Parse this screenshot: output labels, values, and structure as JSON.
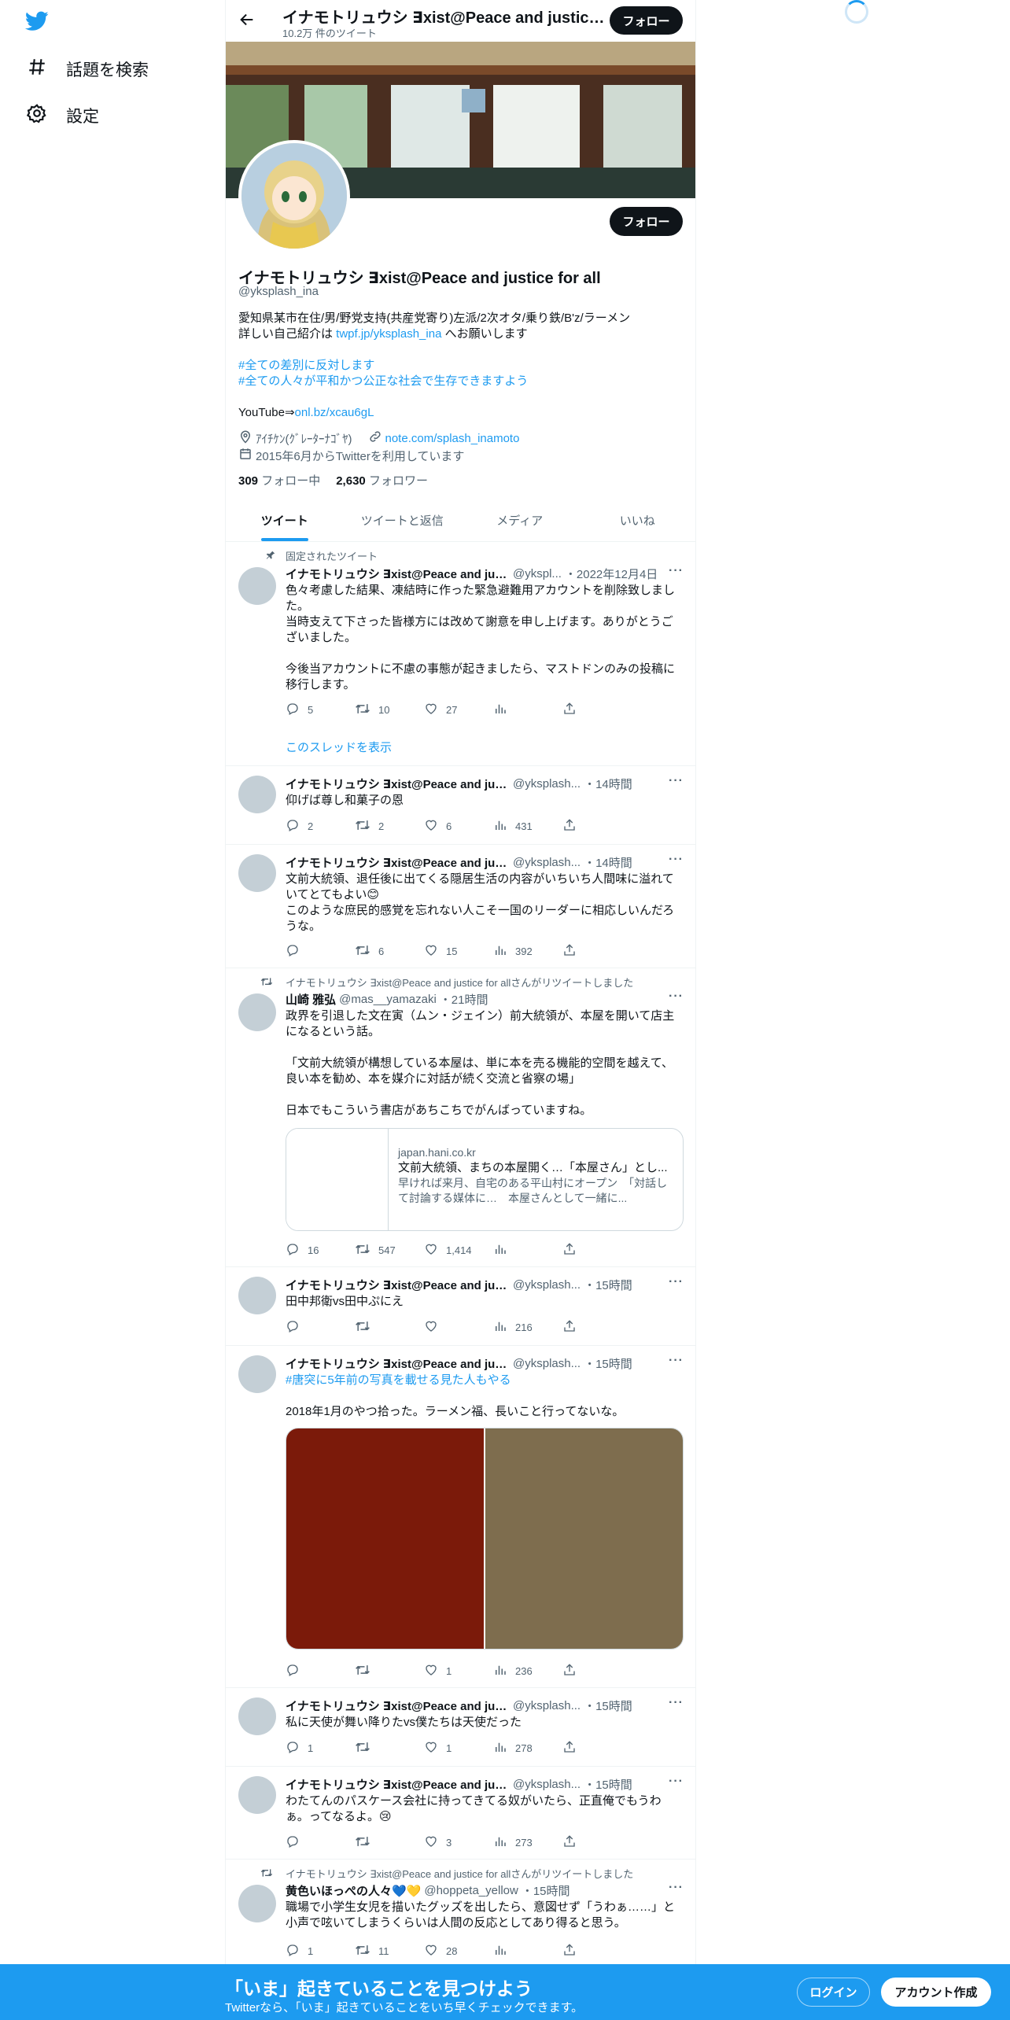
{
  "nav": {
    "explore_label": "話題を検索",
    "settings_label": "設定"
  },
  "header": {
    "title": "イナモトリュウシ ∃xist@Peace and justice for all",
    "tweet_count": "10.2万 件のツイート",
    "follow_label": "フォロー"
  },
  "profile": {
    "follow_label": "フォロー",
    "name": "イナモトリュウシ ∃xist@Peace and justice for all",
    "handle": "@yksplash_ina",
    "bio_line1": "愛知県某市在住/男/野党支持(共産党寄り)左派/2次オタ/乗り鉄/B'z/ラーメン",
    "bio_line2_prefix": "詳しい自己紹介は ",
    "bio_line2_link": "twpf.jp/yksplash_ina",
    "bio_line2_suffix": " へお願いします",
    "bio_hashtag1": "#全ての差別に反対します",
    "bio_hashtag2": "#全ての人々が平和かつ公正な社会で生存できますよう",
    "bio_yt_prefix": "YouTube⇒",
    "bio_yt_link": "onl.bz/xcau6gL",
    "location": "ｱｲﾁｹﾝ(ｸﾞﾚｰﾀｰﾅｺﾞﾔ)",
    "website": "note.com/splash_inamoto",
    "joined": "2015年6月からTwitterを利用しています",
    "following_count": "309",
    "following_label": "フォロー中",
    "followers_count": "2,630",
    "followers_label": "フォロワー"
  },
  "tabs": [
    "ツイート",
    "ツイートと返信",
    "メディア",
    "いいね"
  ],
  "tweets": [
    {
      "pinned_label": "固定されたツイート",
      "name": "イナモトリュウシ ∃xist@Peace and jus...",
      "handle": "@ykspl...",
      "time": "・2022年12月4日",
      "text": "色々考慮した結果、凍結時に作った緊急避難用アカウントを削除致しました。\n当時支えて下さった皆様方には改めて謝意を申し上げます。ありがとうございました。\n\n今後当アカウントに不慮の事態が起きましたら、マストドンのみの投稿に移行します。",
      "replies": "5",
      "retweets": "10",
      "likes": "27",
      "views": "",
      "thread_link": "このスレッドを表示"
    },
    {
      "name": "イナモトリュウシ ∃xist@Peace and justice f...",
      "handle": "@yksplash...",
      "time": "・14時間",
      "text": "仰げば尊し和菓子の恩",
      "replies": "2",
      "retweets": "2",
      "likes": "6",
      "views": "431"
    },
    {
      "name": "イナモトリュウシ ∃xist@Peace and justice f...",
      "handle": "@yksplash...",
      "time": "・14時間",
      "text": "文前大統領、退任後に出てくる隠居生活の内容がいちいち人間味に溢れていてとてもよい😊\nこのような庶民的感覚を忘れない人こそ一国のリーダーに相応しいんだろうな。",
      "replies": "",
      "retweets": "6",
      "likes": "15",
      "views": "392"
    },
    {
      "retweeted_by": "イナモトリュウシ ∃xist@Peace and justice for allさんがリツイートしました",
      "name": "山崎 雅弘",
      "handle": "@mas__yamazaki",
      "time": "・21時間",
      "text": "政界を引退した文在寅（ムン・ジェイン）前大統領が、本屋を開いて店主になるという話。\n\n「文前大統領が構想している本屋は、単に本を売る機能的空間を越えて、良い本を勧め、本を媒介に対話が続く交流と省察の場」\n\n日本でもこういう書店があちこちでがんばっていますね。",
      "card_domain": "japan.hani.co.kr",
      "card_title": "文前大統領、まちの本屋開く…「本屋さん」とし...",
      "card_desc": "早ければ来月、自宅のある平山村にオープン　「対話して討論する媒体に…　本屋さんとして一緒に...",
      "replies": "16",
      "retweets": "547",
      "likes": "1,414",
      "views": ""
    },
    {
      "name": "イナモトリュウシ ∃xist@Peace and justice f...",
      "handle": "@yksplash...",
      "time": "・15時間",
      "text": "田中邦衛vs田中ぷにえ",
      "replies": "",
      "retweets": "",
      "likes": "",
      "views": "216"
    },
    {
      "name": "イナモトリュウシ ∃xist@Peace and justice f...",
      "handle": "@yksplash...",
      "time": "・15時間",
      "hashtag": "#唐突に5年前の写真を載せる見た人もやる",
      "text": "2018年1月のやつ拾った。ラーメン福、長いこと行ってないな。",
      "replies": "",
      "retweets": "",
      "likes": "1",
      "views": "236"
    },
    {
      "name": "イナモトリュウシ ∃xist@Peace and justice f...",
      "handle": "@yksplash...",
      "time": "・15時間",
      "text": "私に天使が舞い降りたvs僕たちは天使だった",
      "replies": "1",
      "retweets": "",
      "likes": "1",
      "views": "278"
    },
    {
      "name": "イナモトリュウシ ∃xist@Peace and justice f...",
      "handle": "@yksplash...",
      "time": "・15時間",
      "text": "わたてんのパスケース会社に持ってきてる奴がいたら、正直俺でもうわぁ。ってなるよ。😢",
      "replies": "",
      "retweets": "",
      "likes": "3",
      "views": "273"
    },
    {
      "retweeted_by": "イナモトリュウシ ∃xist@Peace and justice for allさんがリツイートしました",
      "name": "黄色いほっぺの人々💙💛",
      "handle": "@hoppeta_yellow",
      "time": "・15時間",
      "text": "職場で小学生女児を描いたグッズを出したら、意図せず「うわぁ……」と小声で呟いてしまうくらいは人間の反応としてあり得ると思う。",
      "replies": "1",
      "retweets": "11",
      "likes": "28",
      "views": ""
    }
  ],
  "bottom": {
    "title": "「いま」起きていることを見つけよう",
    "subtitle": "Twitterなら、「いま」起きていることをいち早くチェックできます。",
    "login_label": "ログイン",
    "signup_label": "アカウント作成"
  },
  "colors": {
    "accent": "#1d9bf0",
    "text": "#0f1419",
    "muted": "#536471",
    "media_left": "#7b1a0a",
    "media_right": "#7e6d4e"
  }
}
